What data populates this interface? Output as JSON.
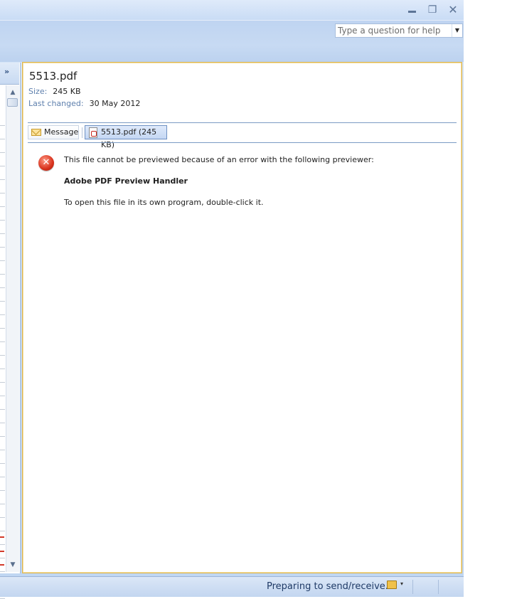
{
  "window": {
    "minimize_glyph": "",
    "maximize_glyph": "❐",
    "close_glyph": "✕"
  },
  "help": {
    "placeholder": "Type a question for help",
    "dropdown_glyph": "▼"
  },
  "left_pane": {
    "chevron_glyph": "»",
    "scroll_up_glyph": "▲",
    "scroll_down_glyph": "▼"
  },
  "reading_pane": {
    "file_name": "5513.pdf",
    "size_label": "Size:",
    "size_value": "245 KB",
    "changed_label": "Last changed:",
    "changed_value": "30 May 2012",
    "attachments": [
      {
        "label": "Message",
        "icon": "envelope-icon",
        "selected": false
      },
      {
        "label": "5513.pdf (245 KB)",
        "icon": "pdf-icon",
        "selected": true
      }
    ],
    "error": {
      "icon": "error-icon",
      "icon_glyph": "✕",
      "message": "This file cannot be previewed because of an error with the following previewer:",
      "handler": "Adobe PDF Preview Handler",
      "hint": "To open this file in its own program, double-click it."
    }
  },
  "status_bar": {
    "text": "Preparing to send/receive...",
    "icon": "send-receive-folder-icon",
    "caret_glyph": "▾"
  },
  "colors": {
    "frame_blue": "#c4d9f3",
    "pane_border": "#e0b64f",
    "label_blue": "#5f80ad",
    "error_red": "#d8321d"
  }
}
